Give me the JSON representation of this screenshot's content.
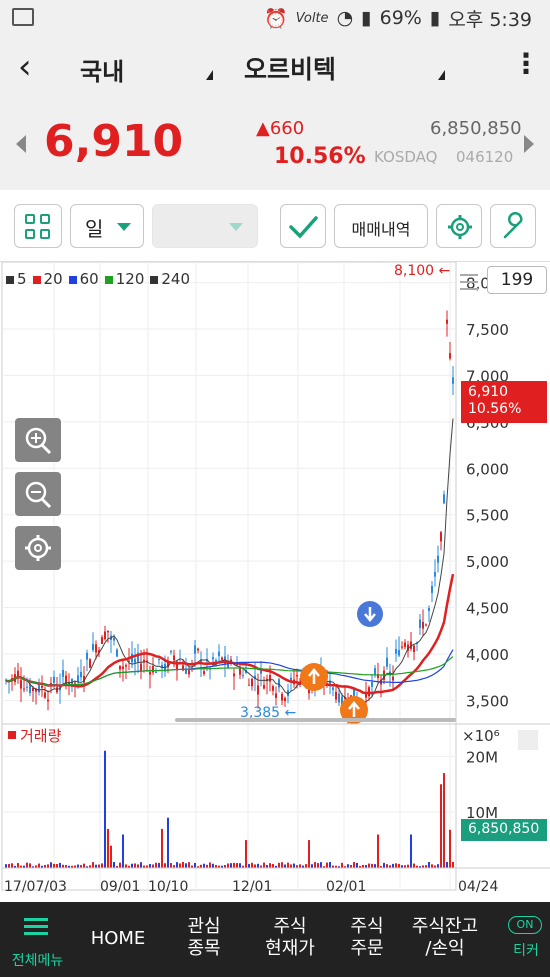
{
  "status_bar": {
    "battery": "69%",
    "time": "오후 5:39",
    "network": "Volte"
  },
  "appbar": {
    "market": "국내",
    "stock_name": "오르비텍",
    "more_icon": "more-vert-icon"
  },
  "quote": {
    "price": "6,910",
    "change": "660",
    "change_pct": "10.56%",
    "volume": "6,850,850",
    "market": "KOSDAQ",
    "code": "046120",
    "up_color": "#e02020"
  },
  "toolbar": {
    "period": "일",
    "trade_history": "매매내역"
  },
  "chart": {
    "count": "199",
    "legend": [
      {
        "label": "5",
        "color": "#333333"
      },
      {
        "label": "20",
        "color": "#e02020"
      },
      {
        "label": "60",
        "color": "#2040e0"
      },
      {
        "label": "120",
        "color": "#20a020"
      },
      {
        "label": "240",
        "color": "#333333"
      }
    ],
    "price_ticks": [
      "8,000",
      "7,500",
      "7,000",
      "6,500",
      "6,000",
      "5,500",
      "5,000",
      "4,500",
      "4,000",
      "3,500"
    ],
    "high_label": "8,100 ←",
    "low_label": "3,385 ←",
    "current_box_price": "6,910",
    "current_box_pct": "10.56%",
    "volume_title": "거래량",
    "volume_unit": "×10⁶",
    "volume_ticks": [
      "20M",
      "10M"
    ],
    "volume_box": "6,850,850",
    "date_ticks": [
      "17/07/03",
      "09/01",
      "10/10",
      "12/01",
      "02/01",
      "04/24"
    ]
  },
  "bottom_nav": {
    "menu": "전체메뉴",
    "home": "HOME",
    "watch_1": "관심",
    "watch_2": "종목",
    "price_1": "주식",
    "price_2": "현재가",
    "order_1": "주식",
    "order_2": "주문",
    "balance_1": "주식잔고",
    "balance_2": "/손익",
    "ticker_toggle": "ON",
    "ticker": "티커"
  },
  "chart_data": {
    "type": "candlestick",
    "y_range": [
      3300,
      8200
    ],
    "x_start": "17/07/03",
    "x_end": "04/24",
    "high": 8100,
    "low": 3385,
    "last_close": 6910,
    "volume_last": 6850850,
    "series": [
      {
        "name": "5",
        "color": "#333333"
      },
      {
        "name": "20",
        "color": "#e02020"
      },
      {
        "name": "60",
        "color": "#2040e0"
      },
      {
        "name": "120",
        "color": "#20a020"
      },
      {
        "name": "240",
        "color": "#333333"
      }
    ]
  }
}
